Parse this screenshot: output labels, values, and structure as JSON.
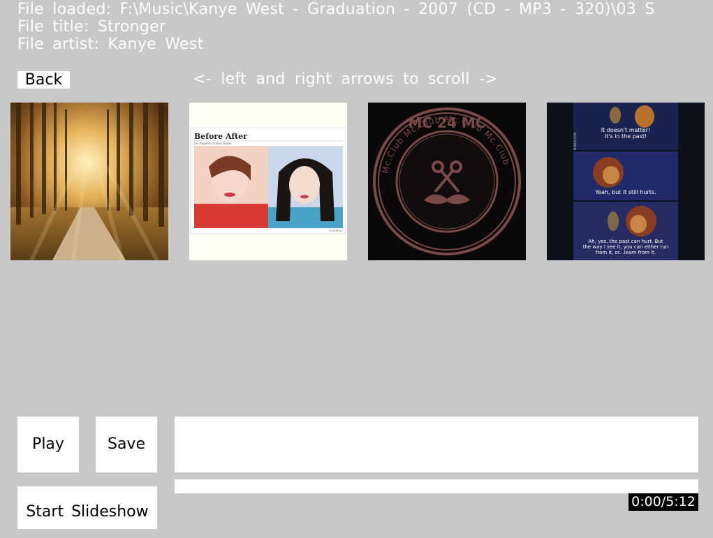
{
  "file_info": {
    "loaded": "File loaded: F:\\Music\\Kanye West - Graduation - 2007 (CD - MP3 - 320)\\03 S",
    "title": "File title: Stronger",
    "artist": "File artist: Kanye West"
  },
  "nav": {
    "back_label": "Back",
    "scroll_hint": "<- left and right arrows to scroll ->"
  },
  "thumbnails": [
    {
      "subject": "sunlit forest path"
    },
    {
      "subject": "before after comparison",
      "heading": "Before After",
      "subheading": "Los Angeles, United States",
      "watermark": "InstaMag"
    },
    {
      "subject": "mc club circular logo",
      "ring_text": "Mc.Club Mc.Club Mc.Club Mc.Club",
      "top_text": "MC 24 MC"
    },
    {
      "subject": "lion king comic panels",
      "captions": [
        "It doesn't matter! It's in the past!",
        "Yeah, but it still hurts.",
        "Ah, yes, the past can hurt. But the way I see it, you can either run from it, or...learn from it."
      ],
      "side_text": "MEMES.COM"
    }
  ],
  "controls": {
    "play_label": "Play",
    "save_label": "Save",
    "slideshow_label": "Start Slideshow"
  },
  "playback": {
    "time": "0:00/5:12",
    "progress": 0
  }
}
